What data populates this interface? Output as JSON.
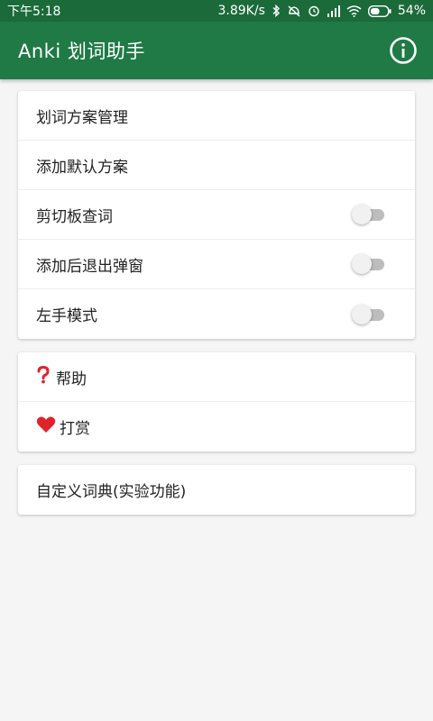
{
  "status_bar": {
    "time": "下午5:18",
    "network_speed": "3.89K/s",
    "battery_percent": "54%"
  },
  "app_bar": {
    "title": "Anki 划词助手",
    "info_icon": "info-circle-icon"
  },
  "settings_card": {
    "items": [
      {
        "label": "划词方案管理"
      },
      {
        "label": "添加默认方案"
      },
      {
        "label": "剪切板查词",
        "toggle": false
      },
      {
        "label": "添加后退出弹窗",
        "toggle": false
      },
      {
        "label": "左手模式",
        "toggle": false
      }
    ]
  },
  "help_card": {
    "items": [
      {
        "label": "帮助",
        "icon": "question-mark-icon"
      },
      {
        "label": "打赏",
        "icon": "heart-icon"
      }
    ]
  },
  "dict_card": {
    "items": [
      {
        "label": "自定义词典(实验功能)"
      }
    ]
  },
  "colors": {
    "status_bar": "#1b6b3a",
    "app_bar": "#1f7a45",
    "background": "#f5f5f5"
  }
}
